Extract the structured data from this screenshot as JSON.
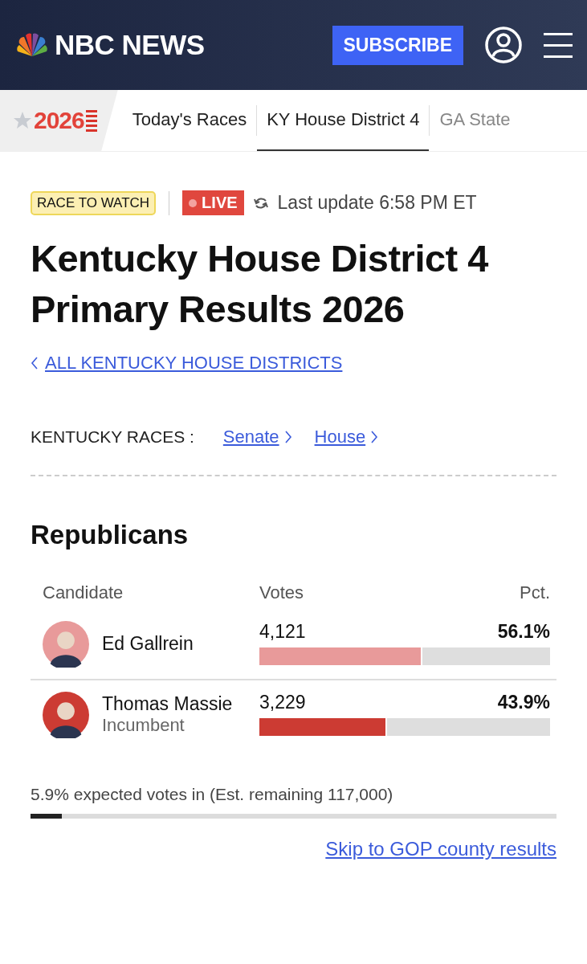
{
  "header": {
    "brand": "NBC NEWS",
    "subscribe": "SUBSCRIBE"
  },
  "nav": {
    "logo": "2026",
    "tabs": [
      {
        "label": "Today's Races",
        "selected": false
      },
      {
        "label": "KY House District 4",
        "selected": true
      },
      {
        "label": "GA State",
        "selected": false
      }
    ]
  },
  "status": {
    "badge": "RACE TO WATCH",
    "live": "LIVE",
    "update": "Last update 6:58 PM ET"
  },
  "title": "Kentucky House District 4 Primary Results 2026",
  "back_link": "ALL KENTUCKY HOUSE DISTRICTS",
  "races": {
    "label": "KENTUCKY RACES :",
    "links": [
      "Senate",
      "House"
    ]
  },
  "party": {
    "name": "Republicans",
    "columns": [
      "Candidate",
      "Votes",
      "Pct."
    ],
    "candidates": [
      {
        "name": "Ed Gallrein",
        "votes": "4,121",
        "pct": "56.1%",
        "level": 0.561,
        "color": "#e89a9a"
      },
      {
        "name": "Thomas Massie",
        "note": "Incumbent",
        "votes": "3,229",
        "pct": "43.9%",
        "level": 0.439,
        "color": "#cc3b33"
      }
    ],
    "expected": "5.9% expected votes in (Est. remaining 117,000)",
    "expected_level": {
      "level": 0.059
    },
    "skip_link": "Skip to GOP county results"
  }
}
